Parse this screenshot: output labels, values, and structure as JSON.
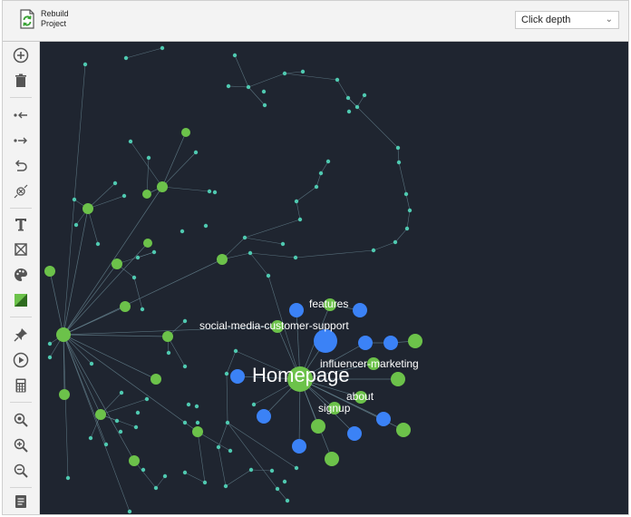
{
  "header": {
    "rebuild_label_line1": "Rebuild",
    "rebuild_label_line2": "Project",
    "depth_select": {
      "value": "Click depth"
    }
  },
  "toolbar": {
    "icons": [
      "add-icon",
      "trash-icon",
      "import-links-icon",
      "export-links-icon",
      "undo-icon",
      "unlink-icon",
      "text-icon",
      "crop-icon",
      "palette-icon",
      "color-square-icon",
      "pin-icon",
      "play-icon",
      "calculator-icon",
      "zoom-fit-icon",
      "zoom-in-icon",
      "zoom-out-icon",
      "notes-icon"
    ]
  },
  "graph": {
    "labels": {
      "homepage": "Homepage",
      "features": "features",
      "social": "social-media-customer-support",
      "influencer": "influencer-marketing",
      "about": "about",
      "signup": "signup"
    },
    "colors": {
      "background": "#1f2530",
      "green": "#6cc24a",
      "blue": "#3b82f6",
      "small": "#4fc9b0",
      "edge": "#6b8a96"
    }
  }
}
